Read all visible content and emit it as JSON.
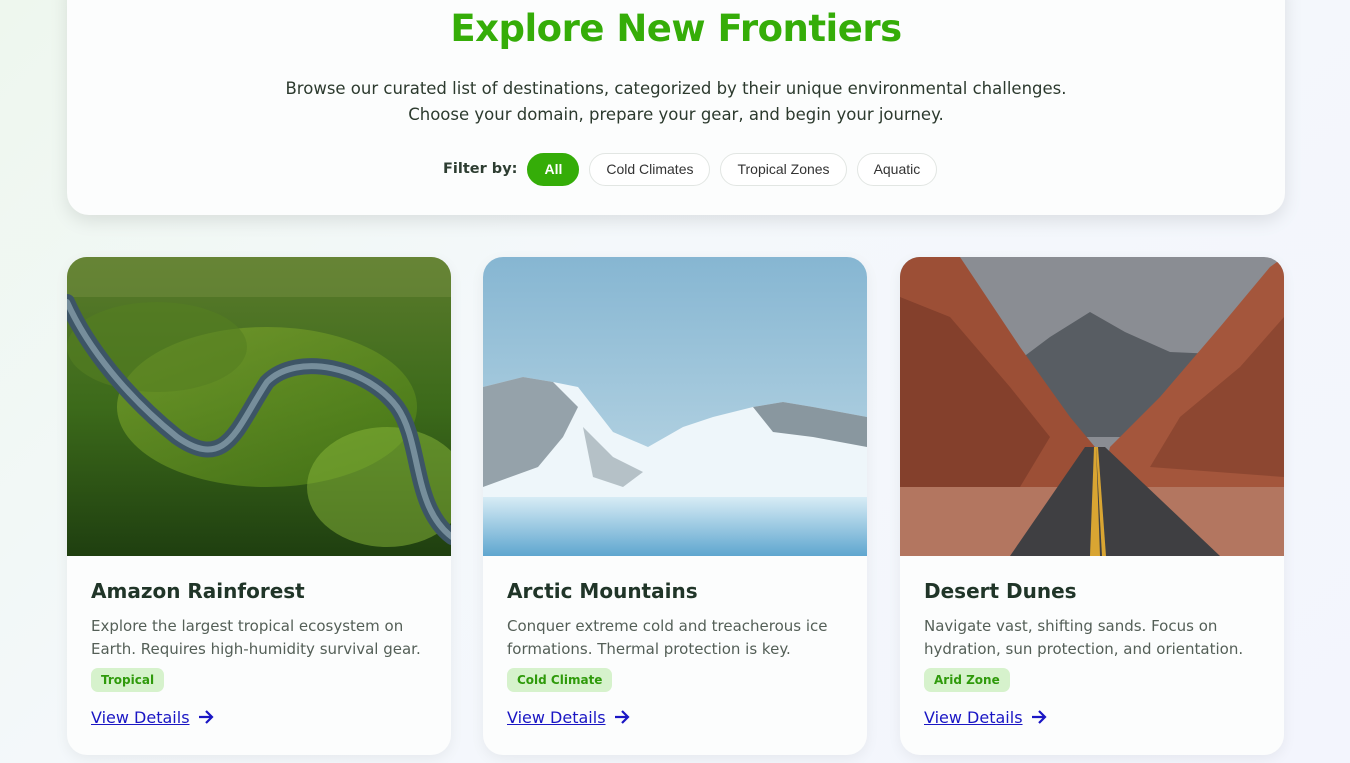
{
  "header": {
    "title": "Explore New Frontiers",
    "subtitle_line1": "Browse our curated list of destinations, categorized by their unique environmental challenges.",
    "subtitle_line2": "Choose your domain, prepare your gear, and begin your journey.",
    "filter_label": "Filter by:",
    "filters": [
      "All",
      "Cold Climates",
      "Tropical Zones",
      "Aquatic"
    ],
    "active_filter": "All"
  },
  "cards": [
    {
      "title": "Amazon Rainforest",
      "description": "Explore the largest tropical ecosystem on Earth. Requires high-humidity survival gear.",
      "tag": "Tropical",
      "link": "View Details",
      "image": "aerial-forest-river"
    },
    {
      "title": "Arctic Mountains",
      "description": "Conquer extreme cold and treacherous ice formations. Thermal protection is key.",
      "tag": "Cold Climate",
      "link": "View Details",
      "image": "snowy-mountains"
    },
    {
      "title": "Desert Dunes",
      "description": "Navigate vast, shifting sands. Focus on hydration, sun protection, and orientation.",
      "tag": "Arid Zone",
      "link": "View Details",
      "image": "desert-canyon-road"
    }
  ],
  "colors": {
    "accent": "#35ad08",
    "tag_bg": "#d6f2cc",
    "link": "#1a16c4",
    "heading": "#203528"
  }
}
